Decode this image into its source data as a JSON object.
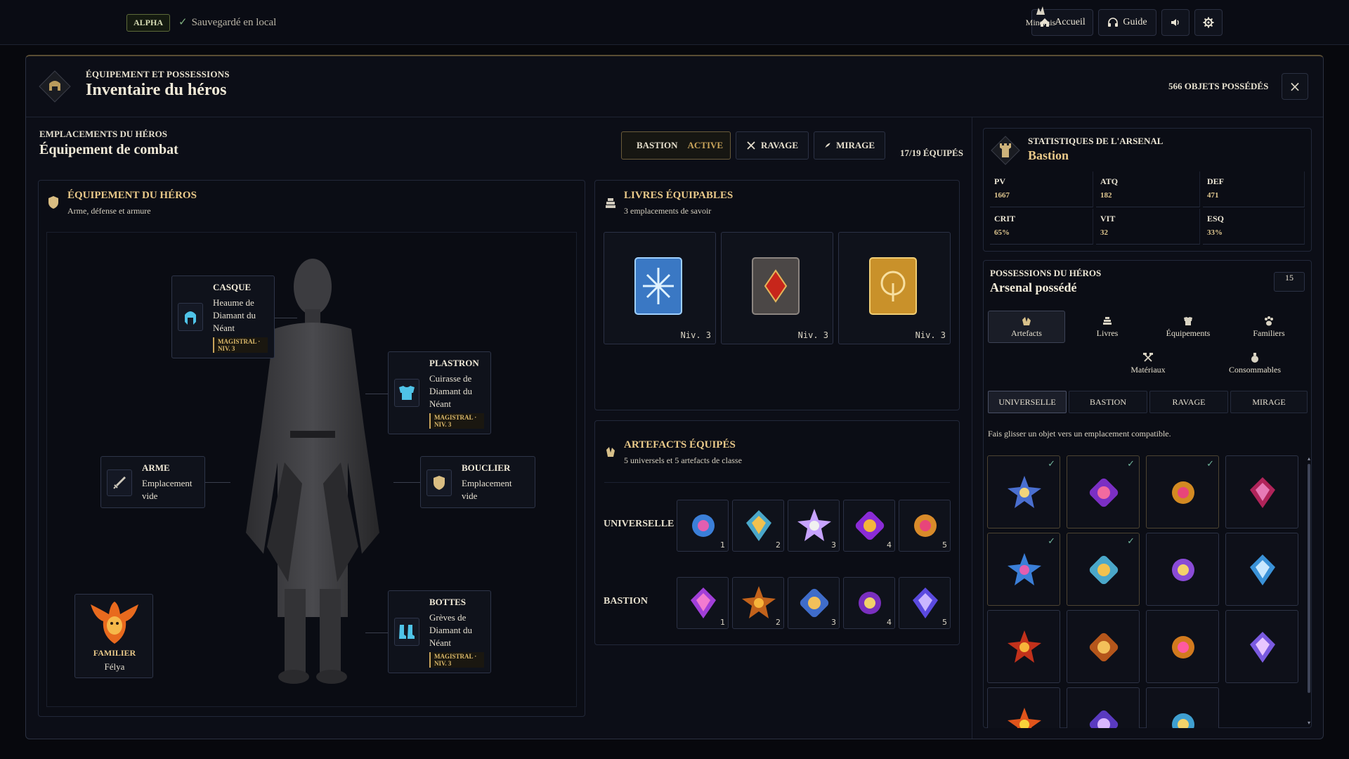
{
  "topbar": {
    "badge": "ALPHA",
    "saved": "Sauvegardé en local",
    "buttons": {
      "home": "Accueil",
      "guide": "Guide"
    }
  },
  "header": {
    "kicker": "ÉQUIPEMENT ET POSSESSIONS",
    "title": "Inventaire du héros",
    "owned": "566 OBJETS POSSÉDÉS",
    "close": "×"
  },
  "left": {
    "kicker": "EMPLACEMENTS DU HÉROS",
    "title": "Équipement de combat",
    "classes": [
      {
        "label": "BASTION",
        "status": "ACTIVE"
      },
      {
        "label": "RAVAGE"
      },
      {
        "label": "MIRAGE"
      }
    ],
    "equipped": "17/19 ÉQUIPÉS"
  },
  "hero_equipment": {
    "title": "ÉQUIPEMENT DU HÉROS",
    "subtitle": "Arme, défense et armure",
    "slots": {
      "casque": {
        "name": "CASQUE",
        "desc": [
          "Heaume de",
          "Diamant du",
          "Néant"
        ],
        "badge": [
          "MAGISTRAL ·",
          "NIV. 3"
        ]
      },
      "plastron": {
        "name": "PLASTRON",
        "desc": [
          "Cuirasse de",
          "Diamant du",
          "Néant"
        ],
        "badge": [
          "MAGISTRAL ·",
          "NIV. 3"
        ]
      },
      "arme": {
        "name": "ARME",
        "desc": [
          "Emplacement",
          "vide"
        ]
      },
      "bouclier": {
        "name": "BOUCLIER",
        "desc": [
          "Emplacement",
          "vide"
        ]
      },
      "bottes": {
        "name": "BOTTES",
        "desc": [
          "Grèves de",
          "Diamant du",
          "Néant"
        ],
        "badge": [
          "MAGISTRAL ·",
          "NIV. 3"
        ]
      },
      "familier": {
        "name": "FAMILIER",
        "value": "Félya"
      }
    }
  },
  "books": {
    "title": "LIVRES ÉQUIPABLES",
    "subtitle": "3 emplacements de savoir",
    "items": [
      {
        "level": "Niv. 3",
        "color": "#4c8fd6"
      },
      {
        "level": "Niv. 3",
        "color": "#6a5f5a"
      },
      {
        "level": "Niv. 3",
        "color": "#c9912a"
      }
    ]
  },
  "artifacts": {
    "title": "ARTEFACTS ÉQUIPÉS",
    "subtitle": "5 universels et 5 artefacts de classe",
    "rows": [
      {
        "label": "UNIVERSELLE",
        "nums": [
          "1",
          "2",
          "3",
          "4",
          "5"
        ]
      },
      {
        "label": "BASTION",
        "nums": [
          "1",
          "2",
          "3",
          "4",
          "5"
        ]
      }
    ]
  },
  "stats": {
    "kicker": "STATISTIQUES DE L'ARSENAL",
    "title": "Bastion",
    "items": [
      {
        "k": "PV",
        "v": "1667"
      },
      {
        "k": "ATQ",
        "v": "182"
      },
      {
        "k": "DEF",
        "v": "471"
      },
      {
        "k": "CRIT",
        "v": "65%"
      },
      {
        "k": "VIT",
        "v": "32"
      },
      {
        "k": "ESQ",
        "v": "33%"
      }
    ]
  },
  "possessions": {
    "kicker": "POSSESSIONS DU HÉROS",
    "title": "Arsenal possédé",
    "count": "15",
    "categories": [
      "Artefacts",
      "Livres",
      "Équipements",
      "Familiers",
      "Minerais",
      "Matériaux",
      "Consommables"
    ],
    "filters": [
      "UNIVERSELLE",
      "BASTION",
      "RAVAGE",
      "MIRAGE"
    ],
    "hint": "Fais glisser un objet vers un emplacement compatible."
  },
  "colors": {
    "accent": "#c9a45a",
    "gold": "#e9c989",
    "bg": "#0c0e17",
    "check": "#6fb39a"
  },
  "icons": [
    "shield-icon",
    "home-icon",
    "headphones-icon",
    "speaker-icon",
    "gear-icon",
    "close-icon",
    "sword-icon",
    "book-icon",
    "crystal-icon",
    "tower-icon"
  ]
}
